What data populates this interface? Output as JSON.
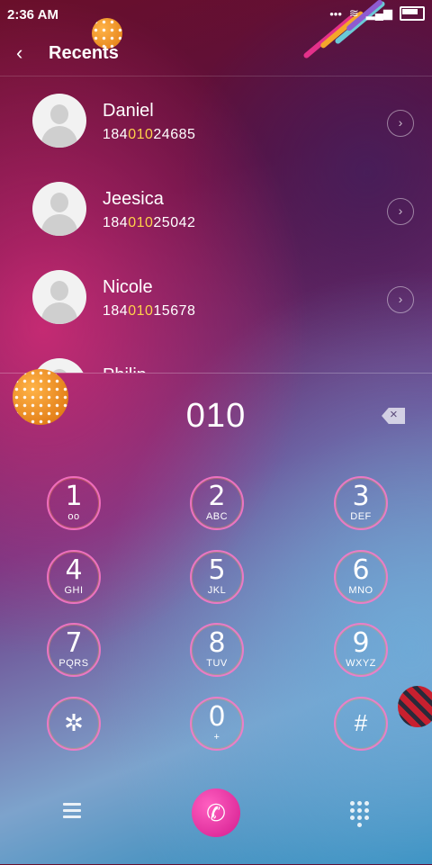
{
  "status_bar": {
    "time": "2:36 AM",
    "more": "•••",
    "wifi": "≋",
    "signal": "▂▄▆"
  },
  "header": {
    "title": "Recents",
    "back_icon": "‹"
  },
  "recents": [
    {
      "name": "Daniel",
      "number_prefix": "184",
      "number_match": "010",
      "number_suffix": "24685"
    },
    {
      "name": "Jeesica",
      "number_prefix": "184",
      "number_match": "010",
      "number_suffix": "25042"
    },
    {
      "name": "Nicole",
      "number_prefix": "184",
      "number_match": "010",
      "number_suffix": "15678"
    },
    {
      "name": "Philip"
    }
  ],
  "dialer": {
    "digits": "010"
  },
  "keys": [
    {
      "digit": "1",
      "letters": "ᴏᴏ"
    },
    {
      "digit": "2",
      "letters": "ABC"
    },
    {
      "digit": "3",
      "letters": "DEF"
    },
    {
      "digit": "4",
      "letters": "GHI"
    },
    {
      "digit": "5",
      "letters": "JKL"
    },
    {
      "digit": "6",
      "letters": "MNO"
    },
    {
      "digit": "7",
      "letters": "PQRS"
    },
    {
      "digit": "8",
      "letters": "TUV"
    },
    {
      "digit": "9",
      "letters": "WXYZ"
    },
    {
      "symbol": "✲"
    },
    {
      "digit": "0",
      "letters": "+"
    },
    {
      "symbol": "#"
    }
  ],
  "bottom": {
    "call_icon": "✆",
    "chevron": "›"
  },
  "colors": {
    "highlight": "#ffd24a",
    "key_ring": "#ff78c8",
    "call": "#d31b8f"
  }
}
